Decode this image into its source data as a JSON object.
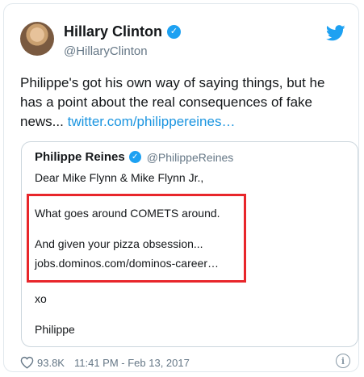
{
  "tweet": {
    "author_name": "Hillary Clinton",
    "author_handle": "@HillaryClinton",
    "verified_mark": "✓",
    "text": "Philippe's got his own way of saying things, but he has a point about the real consequences of fake news...",
    "link_text": "twitter.com/philippereines…"
  },
  "quoted_tweet": {
    "author_name": "Philippe Reines",
    "author_handle": "@PhilippeReines",
    "verified_mark": "✓",
    "lines": {
      "greeting": "Dear Mike Flynn & Mike Flynn Jr.,",
      "comets": "What goes around COMETS around.",
      "pizza": "And given your pizza obsession...",
      "link": "jobs.dominos.com/dominos-career…",
      "xo": "xo",
      "signoff": "Philippe"
    }
  },
  "footer": {
    "likes": "93.8K",
    "timestamp": "11:41 PM - Feb 13, 2017",
    "info_glyph": "i"
  },
  "icons": {
    "avatar": "avatar-image",
    "verified": "verified-badge-icon",
    "twitter_logo": "twitter-bird-icon",
    "like": "heart-icon",
    "info": "info-icon"
  },
  "colors": {
    "accent": "#1da1f2",
    "link": "#1b95e0",
    "highlight": "#e8262b",
    "muted": "#657786"
  }
}
